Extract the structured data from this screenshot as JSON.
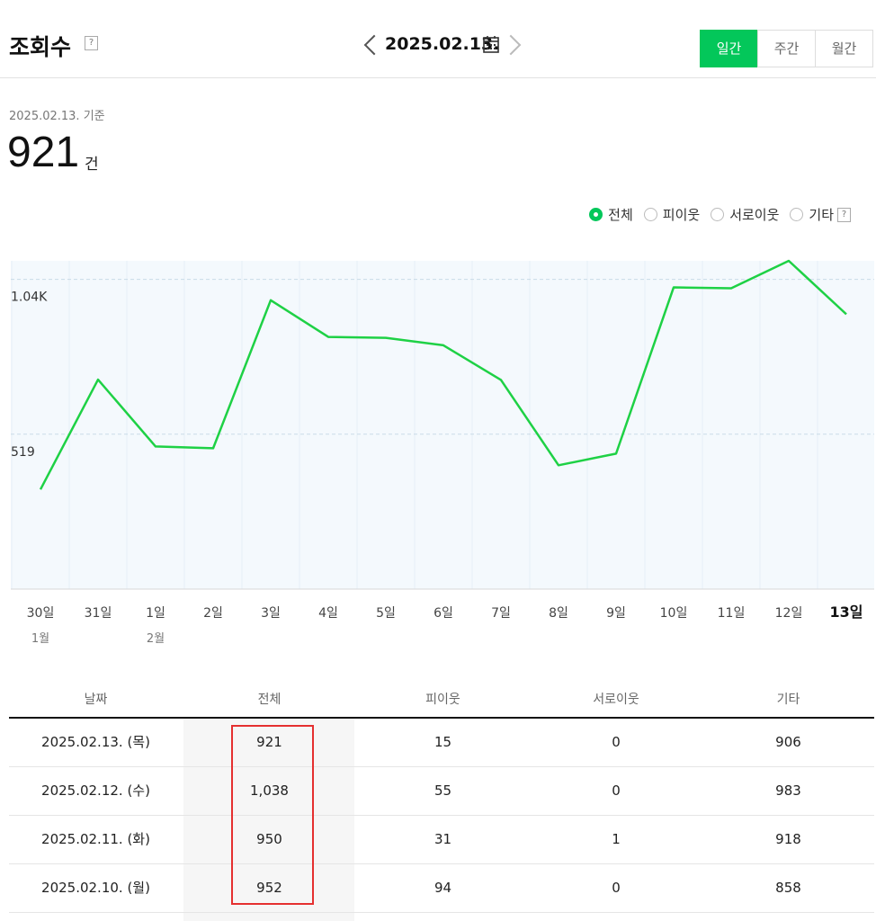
{
  "header": {
    "title": "조회수",
    "help": "?",
    "date": "2025.02.13.",
    "periods": [
      "일간",
      "주간",
      "월간"
    ],
    "active_period": "일간"
  },
  "summary": {
    "date_label": "2025.02.13. 기준",
    "value": "921",
    "unit": "건"
  },
  "legend": {
    "options": [
      "전체",
      "피이웃",
      "서로이웃",
      "기타"
    ],
    "selected": "전체",
    "help": "?"
  },
  "colors": {
    "accent": "#03c75a",
    "highlight": "#e53030"
  },
  "chart_data": {
    "type": "line",
    "categories": [
      "30일",
      "31일",
      "1일",
      "2일",
      "3일",
      "4일",
      "5일",
      "6일",
      "7일",
      "8일",
      "9일",
      "10일",
      "11일",
      "12일",
      "13일"
    ],
    "month_labels": {
      "0": "1월",
      "2": "2월"
    },
    "values": [
      334,
      702,
      478,
      472,
      968,
      845,
      842,
      817,
      701,
      415,
      454,
      1011,
      1008,
      1100,
      921
    ],
    "yticks": [
      519,
      1038
    ],
    "ytick_labels": [
      "519",
      "1.04K"
    ],
    "ylim": [
      0,
      1100
    ],
    "highlight_category": "13일",
    "grid": true
  },
  "table": {
    "columns": [
      "날짜",
      "전체",
      "피이웃",
      "서로이웃",
      "기타"
    ],
    "rows": [
      [
        "2025.02.13. (목)",
        "921",
        "15",
        "0",
        "906"
      ],
      [
        "2025.02.12. (수)",
        "1,038",
        "55",
        "0",
        "983"
      ],
      [
        "2025.02.11. (화)",
        "950",
        "31",
        "1",
        "918"
      ],
      [
        "2025.02.10. (월)",
        "952",
        "94",
        "0",
        "858"
      ]
    ]
  }
}
